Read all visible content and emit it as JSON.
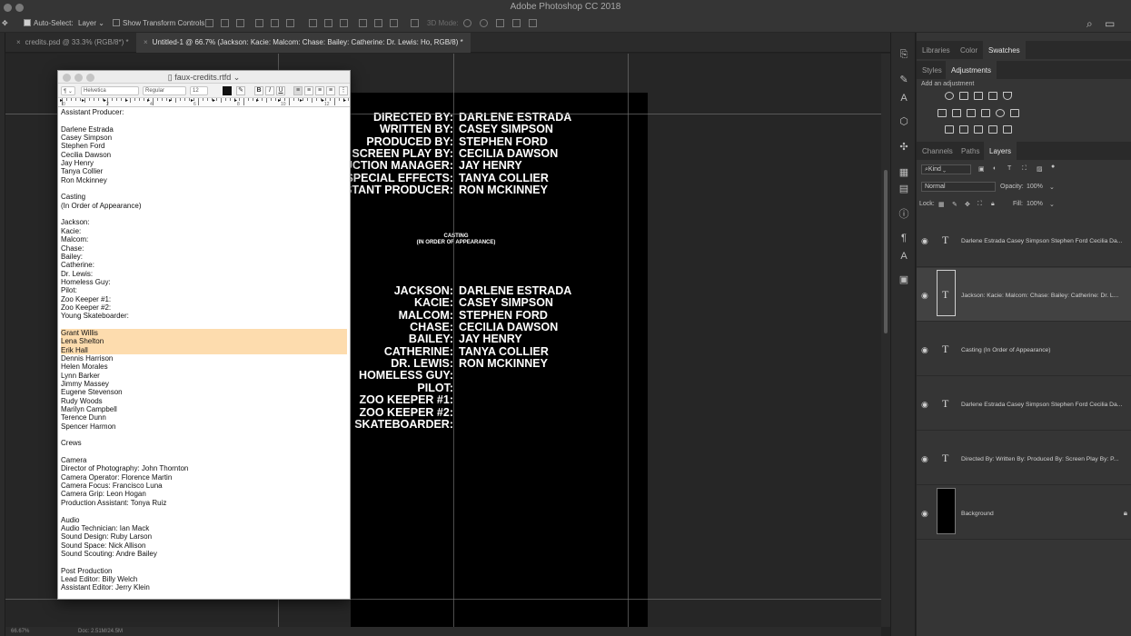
{
  "app": {
    "title": "Adobe Photoshop CC 2018"
  },
  "options_bar": {
    "auto_select_label": "Auto-Select:",
    "auto_select_value": "Layer",
    "show_transform_label": "Show Transform Controls",
    "mode_3d_label": "3D Mode:"
  },
  "doc_tabs": [
    {
      "label": "credits.psd @ 33.3% (RGB/8*) *"
    },
    {
      "label": "Untitled-1 @ 66.7% (Jackson: Kacie: Malcom: Chase: Bailey: Catherine: Dr. Lewis: Ho, RGB/8) *"
    }
  ],
  "canvas": {
    "top_roles": [
      "DIRECTED BY:",
      "WRITTEN BY:",
      "PRODUCED BY:",
      "SCREEN PLAY BY:",
      "PRODUCTION MANAGER:",
      "SPECIAL EFFECTS:",
      "ASSISTANT PRODUCER:"
    ],
    "top_names": [
      "DARLENE ESTRADA",
      "CASEY SIMPSON",
      "STEPHEN FORD",
      "CECILIA DAWSON",
      "JAY HENRY",
      "TANYA COLLIER",
      "RON MCKINNEY"
    ],
    "casting_heading": "CASTING",
    "casting_subheading": "(IN ORDER OF APPEARANCE)",
    "cast_roles": [
      "JACKSON:",
      "KACIE:",
      "MALCOM:",
      "CHASE:",
      "BAILEY:",
      "CATHERINE:",
      "DR. LEWIS:",
      "HOMELESS GUY:",
      "PILOT:",
      "ZOO KEEPER #1:",
      "ZOO KEEPER #2:",
      "YOUNG SKATEBOARDER:"
    ],
    "cast_names": [
      "DARLENE ESTRADA",
      "CASEY SIMPSON",
      "STEPHEN FORD",
      "CECILIA DAWSON",
      "JAY HENRY",
      "TANYA COLLIER",
      "RON MCKINNEY"
    ]
  },
  "editor": {
    "title": "faux-credits.rtfd",
    "font_family": "Helvetica",
    "font_style": "Regular",
    "font_size": "12",
    "lines": [
      "Assistant Producer:",
      "",
      "Darlene Estrada",
      "Casey Simpson",
      "Stephen Ford",
      "Cecilia Dawson",
      "Jay Henry",
      "Tanya Collier",
      "Ron Mckinney",
      "",
      "Casting",
      "(In Order of Appearance)",
      "",
      "Jackson:",
      "Kacie:",
      "Malcom:",
      "Chase:",
      "Bailey:",
      "Catherine:",
      "Dr. Lewis:",
      "Homeless Guy:",
      "Pilot:",
      "Zoo Keeper #1:",
      "Zoo Keeper #2:",
      "Young Skateboarder:",
      "",
      "Grant Willis",
      "Lena Shelton",
      "Erik Hall",
      "Dennis Harrison",
      "Helen Morales",
      "Lynn Barker",
      "Jimmy Massey",
      "Eugene Stevenson",
      "Rudy Woods",
      "Marilyn Campbell",
      "Terence Dunn",
      "Spencer Harmon",
      "",
      "Crews",
      "",
      "Camera",
      "Director of Photography: John Thornton",
      "Camera Operator: Florence Martin",
      "Camera Focus: Francisco Luna",
      "Camera Grip: Leon Hogan",
      "Production Assistant: Tonya Ruiz",
      "",
      "Audio",
      "Audio Technician: Ian Mack",
      "Sound Design: Ruby Larson",
      "Sound Space: Nick Allison",
      "Sound Scouting: Andre Bailey",
      "",
      "Post Production",
      "Lead Editor: Billy Welch",
      "Assistant Editor: Jerry Klein"
    ],
    "highlight_color": "#fddcae"
  },
  "panels": {
    "top_tabs": [
      "Libraries",
      "Color",
      "Swatches"
    ],
    "second_tabs": [
      "Styles",
      "Adjustments"
    ],
    "add_adjustment_label": "Add an adjustment",
    "layer_tabs": [
      "Channels",
      "Paths",
      "Layers"
    ],
    "filter_kind": "Kind",
    "blend_mode": "Normal",
    "opacity_label": "Opacity:",
    "opacity_value": "100%",
    "lock_label": "Lock:",
    "fill_label": "Fill:",
    "fill_value": "100%"
  },
  "layers": [
    {
      "name": "Darlene Estrada Casey Simpson Stephen Ford Cecilia Da...",
      "kind": "text"
    },
    {
      "name": "Jackson: Kacie: Malcom: Chase: Bailey: Catherine: Dr. L...",
      "kind": "text",
      "selected": true
    },
    {
      "name": "Casting (In Order of Appearance)",
      "kind": "text"
    },
    {
      "name": "Darlene Estrada Casey Simpson Stephen Ford Cecilia Da...",
      "kind": "text"
    },
    {
      "name": "Directed By: Written By: Produced By: Screen Play By: P...",
      "kind": "text"
    },
    {
      "name": "Background",
      "kind": "image",
      "locked": true
    }
  ],
  "status": {
    "zoom": "66.67%",
    "doc": "Doc: 2.51M/24.5M"
  }
}
